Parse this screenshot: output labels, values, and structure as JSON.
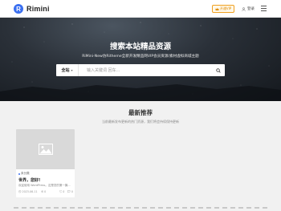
{
  "header": {
    "logo_letter": "R",
    "logo_text": "Rimini",
    "vip_label": "开通VIP",
    "login_label": "登录"
  },
  "hero": {
    "title": "搜索本站精品资源",
    "subtitle": "RiMini-New仿Ritheme全新开发精品网VIP会员资源/素材虚拟商城主题",
    "search": {
      "category": "全站",
      "placeholder": "输入关键词 回车..."
    }
  },
  "section": {
    "title": "最新推荐",
    "subtitle": "当前最新发布更新的热门资源，我们将会持续保持更新"
  },
  "card": {
    "category": "未分类",
    "title": "世界，您好!",
    "excerpt": "欢迎使用 WordPress。这是您的第一篇...",
    "date": "2023-06-11",
    "views": "0",
    "likes": "0",
    "comments": "0"
  },
  "colors": {
    "accent": "#3a6ff0",
    "vip": "#f0a020"
  }
}
